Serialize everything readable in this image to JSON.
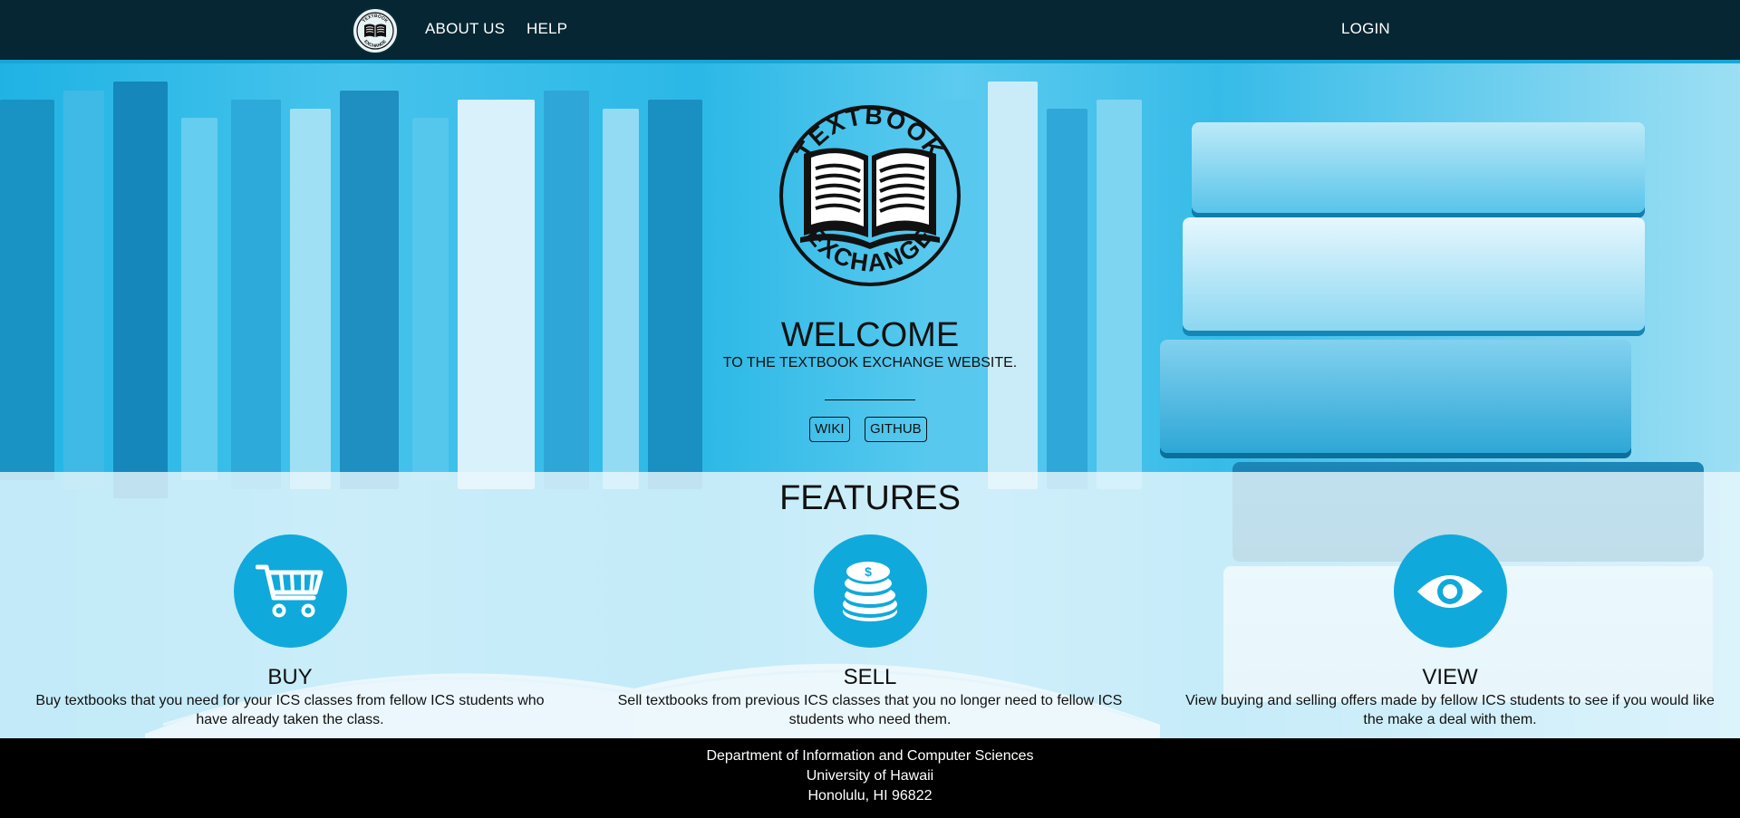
{
  "nav": {
    "logo_icon": "textbook-exchange-logo-icon",
    "about_label": "ABOUT US",
    "help_label": "HELP",
    "login_label": "LOGIN"
  },
  "hero": {
    "logo_top_text": "TEXTBOOK",
    "logo_bottom_text": "EXCHANGE",
    "title": "WELCOME",
    "subtitle": "TO THE TEXTBOOK EXCHANGE WEBSITE.",
    "buttons": {
      "wiki": "WIKI",
      "github": "GITHUB"
    }
  },
  "features": {
    "title": "FEATURES",
    "items": [
      {
        "icon": "shopping-cart-icon",
        "title": "BUY",
        "description": "Buy textbooks that you need for your ICS classes from fellow ICS students who have already taken the class."
      },
      {
        "icon": "coins-icon",
        "title": "SELL",
        "description": "Sell textbooks from previous ICS classes that you no longer need to fellow ICS students who need them."
      },
      {
        "icon": "eye-icon",
        "title": "VIEW",
        "description": "View buying and selling offers made by fellow ICS students to see if you would like the make a deal with them."
      }
    ]
  },
  "footer": {
    "line1": "Department of Information and Computer Sciences",
    "line2": "University of Hawaii",
    "line3": "Honolulu, HI 96822"
  },
  "colors": {
    "navbar": "#072633",
    "accent": "#10a9dc",
    "footer": "#000000"
  }
}
